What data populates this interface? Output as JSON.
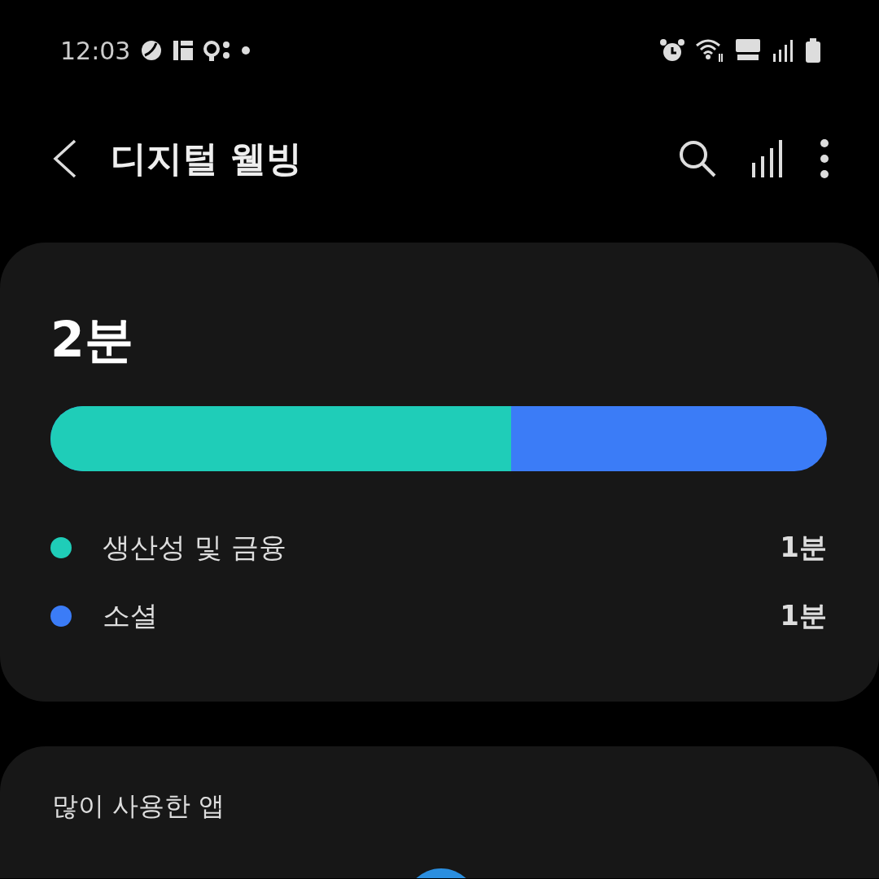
{
  "status_bar": {
    "time": "12:03"
  },
  "app_bar": {
    "title": "디지털 웰빙"
  },
  "summary": {
    "total": "2분",
    "categories": [
      {
        "name": "생산성 및 금융",
        "time": "1분",
        "color": "#1fcdb8",
        "level": 0.593
      },
      {
        "name": "소셜",
        "time": "1분",
        "color": "#3b7cf7"
      }
    ]
  },
  "most_used": {
    "title": "많이 사용한 앱"
  }
}
